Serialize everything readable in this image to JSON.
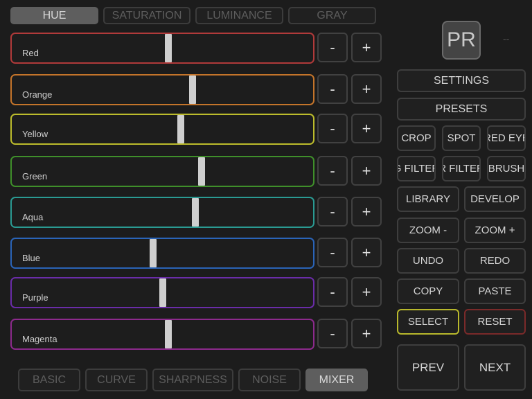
{
  "top_tabs": [
    "HUE",
    "SATURATION",
    "LUMINANCE",
    "GRAY"
  ],
  "sliders": [
    {
      "label": "Red",
      "color": "#b13a3a",
      "value": 0.52
    },
    {
      "label": "Orange",
      "color": "#c4742a",
      "value": 0.6
    },
    {
      "label": "Yellow",
      "color": "#bcbc2c",
      "value": 0.56
    },
    {
      "label": "Green",
      "color": "#3f8f2a",
      "value": 0.63
    },
    {
      "label": "Aqua",
      "color": "#2a9a92",
      "value": 0.61
    },
    {
      "label": "Blue",
      "color": "#2a64b8",
      "value": 0.47
    },
    {
      "label": "Purple",
      "color": "#6a2ca8",
      "value": 0.5
    },
    {
      "label": "Magenta",
      "color": "#8c2a8c",
      "value": 0.52
    }
  ],
  "minus_label": "-",
  "plus_label": "+",
  "logo_text": "PR",
  "status_text": "--",
  "right_panel": {
    "settings": "SETTINGS",
    "presets": "PRESETS",
    "crop": "CROP",
    "spot": "SPOT",
    "red_eye": "RED EYE",
    "g_filter": "G FILTER",
    "r_filter": "R FILTER",
    "brush": "BRUSH",
    "library": "LIBRARY",
    "develop": "DEVELOP",
    "zoom_out": "ZOOM  -",
    "zoom_in": "ZOOM +",
    "undo": "UNDO",
    "redo": "REDO",
    "copy": "COPY",
    "paste": "PASTE",
    "select": "SELECT",
    "reset": "RESET",
    "prev": "PREV",
    "next": "NEXT",
    "select_color": "#b8b82c",
    "reset_color": "#7a2a2a"
  },
  "bottom_tabs": [
    "BASIC",
    "CURVE",
    "SHARPNESS",
    "NOISE",
    "MIXER"
  ]
}
